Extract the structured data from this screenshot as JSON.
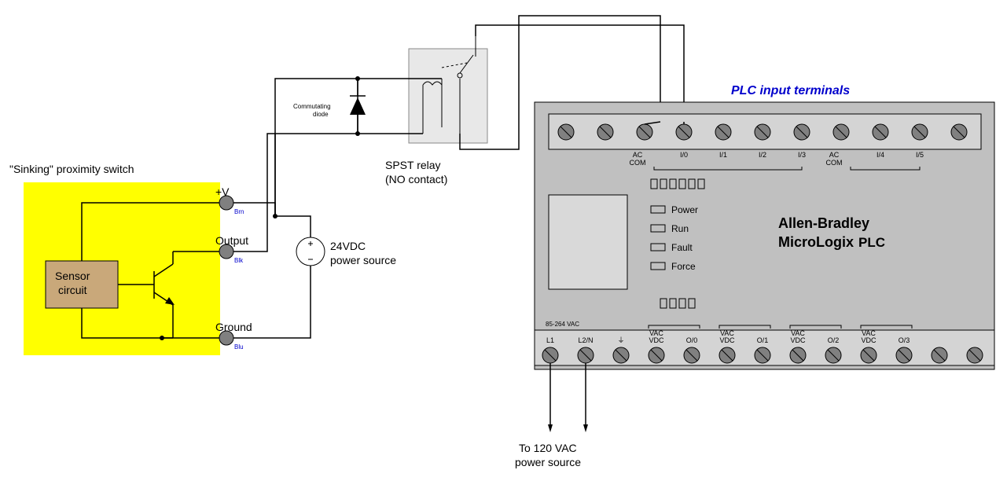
{
  "proximity": {
    "title": "\"Sinking\" proximity switch",
    "sensor_label": "Sensor\ncircuit",
    "terminals": {
      "vplus": {
        "label": "+V",
        "wire_color": "Brn"
      },
      "output": {
        "label": "Output",
        "wire_color": "Blk"
      },
      "ground": {
        "label": "Ground",
        "wire_color": "Blu"
      }
    }
  },
  "dc_source": {
    "label": "24VDC\npower source"
  },
  "diode_label": "Commutating\ndiode",
  "relay": {
    "title": "SPST relay\n(NO contact)"
  },
  "plc": {
    "header": "PLC input terminals",
    "brand": "Allen-Bradley",
    "model": "MicroLogix",
    "type_suffix": "PLC",
    "status_leds": [
      "Power",
      "Run",
      "Fault",
      "Force"
    ],
    "input_range_label": "85-264 VAC",
    "input_terminals": [
      "",
      "AC\nCOM",
      "I/0",
      "I/1",
      "I/2",
      "I/3",
      "AC\nCOM",
      "I/4",
      "I/5",
      "",
      ""
    ],
    "output_terminals": [
      "L1",
      "L2/N",
      "⏚",
      "VAC\nVDC",
      "O/0",
      "VAC\nVDC",
      "O/1",
      "VAC\nVDC",
      "O/2",
      "VAC\nVDC",
      "O/3",
      "",
      ""
    ]
  },
  "chart_data": {
    "type": "circuit-diagram",
    "nodes": [
      {
        "id": "prox",
        "type": "proximity-sensor-npn-sinking",
        "terminals": [
          "+V",
          "Output",
          "Ground"
        ]
      },
      {
        "id": "dc",
        "type": "dc-source",
        "voltage": 24,
        "unit": "VDC"
      },
      {
        "id": "diode",
        "type": "diode",
        "role": "commutating"
      },
      {
        "id": "relay",
        "type": "relay-spst-no"
      },
      {
        "id": "plc",
        "type": "plc",
        "model": "Allen-Bradley MicroLogix",
        "mains": "120 VAC",
        "input_mode": "AC"
      }
    ],
    "connections": [
      {
        "from": "dc.+",
        "to": "prox.+V"
      },
      {
        "from": "dc.+",
        "to": "relay.coil.A"
      },
      {
        "from": "relay.coil.B",
        "to": "prox.Output"
      },
      {
        "from": "diode.anode",
        "to": "prox.Output"
      },
      {
        "from": "diode.cathode",
        "to": "dc.+"
      },
      {
        "from": "dc.-",
        "to": "prox.Ground"
      },
      {
        "from": "relay.contact.common",
        "to": "plc.I/0"
      },
      {
        "from": "relay.contact.no",
        "to": "plc.AC_COM (via mains hot)"
      },
      {
        "from": "plc.L1",
        "to": "120VAC.hot"
      },
      {
        "from": "plc.L2/N",
        "to": "120VAC.neutral"
      }
    ]
  },
  "mains_label": "To 120 VAC\npower source"
}
